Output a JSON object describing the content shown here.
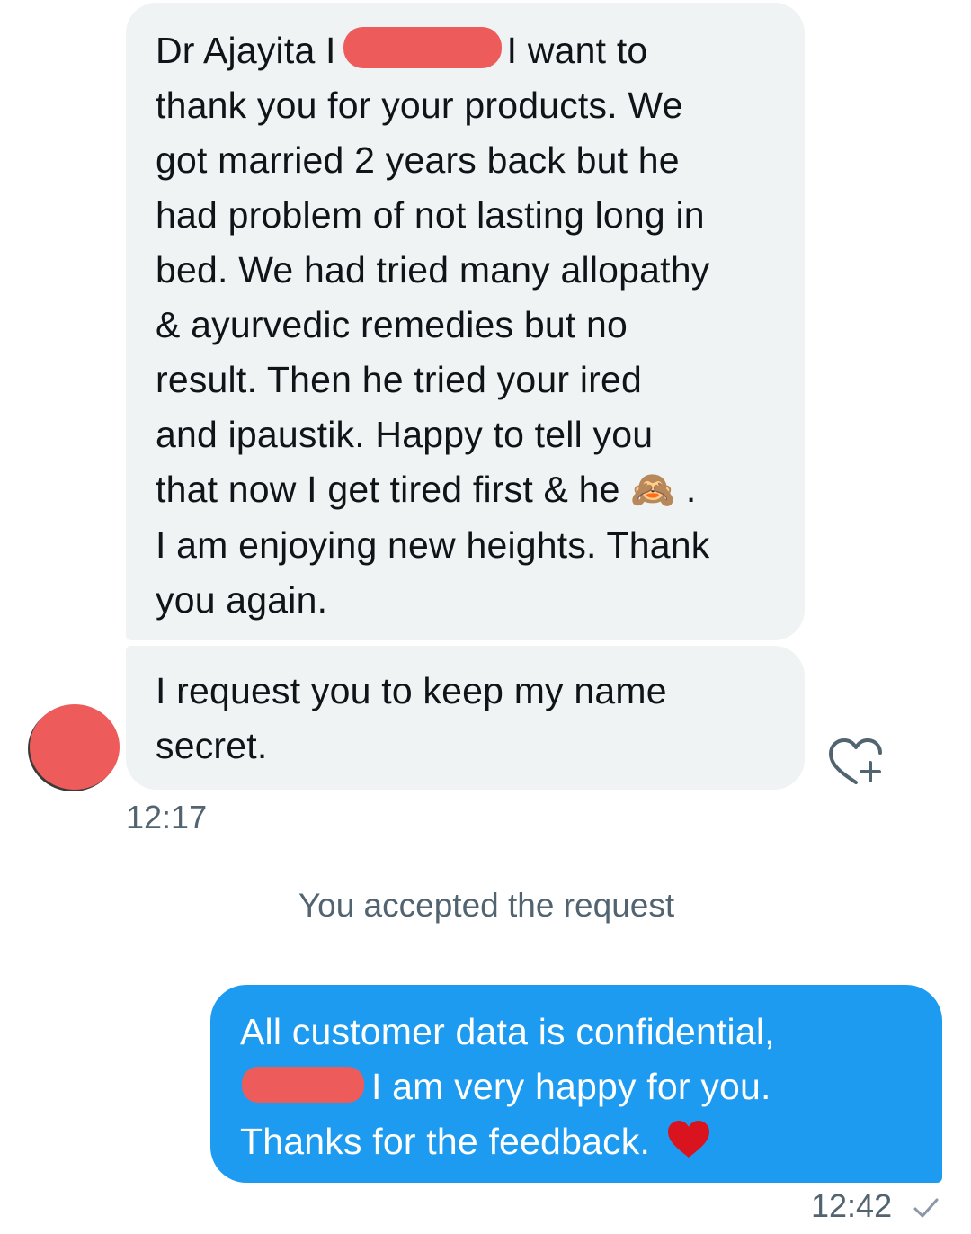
{
  "incoming": {
    "message1": {
      "line1_prefix": "Dr Ajayita I",
      "line1_suffix": "I want to",
      "lines": [
        "thank you for your products. We",
        "got married 2 years back but he",
        "had problem of not lasting long in",
        "bed. We had tried many allopathy",
        "& ayurvedic remedies but no",
        "result. Then he tried your ired",
        "and ipaustik. Happy to tell you"
      ],
      "line9_prefix": "that now I get tired first & he",
      "emoji": "🙈",
      "line9_suffix": ".",
      "lines_end": [
        "I am enjoying new heights. Thank",
        "you again."
      ]
    },
    "message2": {
      "lines": [
        "I request you to keep my name",
        "secret."
      ]
    },
    "timestamp": "12:17"
  },
  "system_message": "You accepted the request",
  "outgoing": {
    "line1": "All customer data is confidential,",
    "line2_suffix": "I am very happy for you.",
    "line3": "Thanks for the feedback.",
    "timestamp": "12:42"
  },
  "icons": {
    "react": "heart-plus-icon",
    "heart": "red-heart-icon",
    "read_receipt": "checkmark-icon",
    "emoji": "see-no-evil-monkey-icon"
  },
  "colors": {
    "incoming_bubble": "#eff3f4",
    "outgoing_bubble": "#1d9bf0",
    "redaction": "#ee5b5b",
    "secondary_text": "#536471",
    "heart": "#d9141f"
  }
}
